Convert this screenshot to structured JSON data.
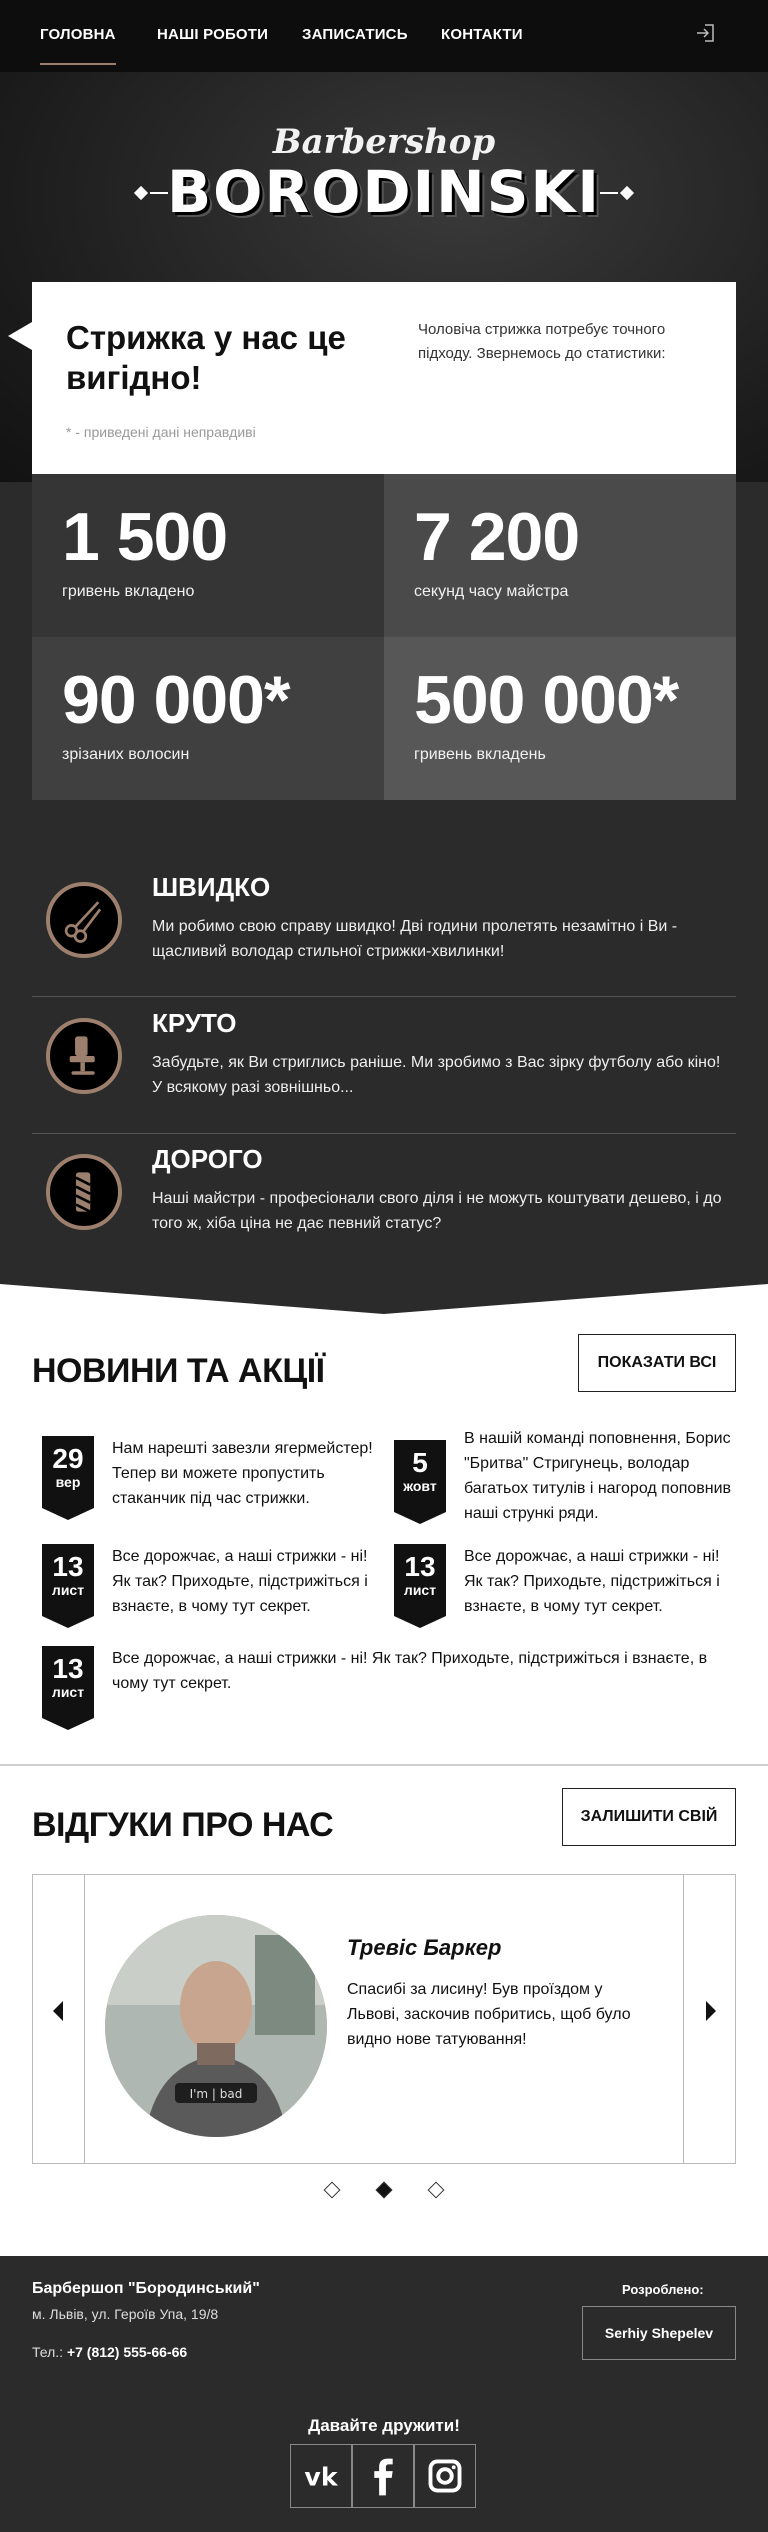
{
  "nav": {
    "items": [
      {
        "label": "ГОЛОВНА"
      },
      {
        "label": "НАШІ РОБОТИ"
      },
      {
        "label": "ЗАПИСАТИСЬ"
      },
      {
        "label": "КОНТАКТИ"
      }
    ],
    "login_icon": "login-icon"
  },
  "hero": {
    "script": "Barbershop",
    "title": "BORODINSKI"
  },
  "intro": {
    "title": "Стрижка у нас це вигідно!",
    "note": "* - приведені дані неправдиві",
    "text": "Чоловіча стрижка потребує точного підходу. Звернемось до статистики:"
  },
  "stats": [
    {
      "value": "1 500",
      "label": "гривень вкладено",
      "color": "#353535"
    },
    {
      "value": "7 200",
      "label": "секунд часу майстра",
      "color": "#4a4a4a"
    },
    {
      "value": "90 000*",
      "label": "зрізаних волосин",
      "color": "#404040"
    },
    {
      "value": "500 000*",
      "label": "гривень вкладень",
      "color": "#575757"
    }
  ],
  "features": [
    {
      "title": "ШВИДКО",
      "text": "Ми робимо свою справу швидко! Дві години пролетять незамітно і Ви - щасливий володар стильної стрижки-хвилинки!",
      "icon": "scissors-icon"
    },
    {
      "title": "КРУТО",
      "text": "Забудьте, як Ви стриглись раніше. Ми зробимо з Вас зірку футболу або кіно! У всякому разі зовнішньо...",
      "icon": "barber-chair-icon"
    },
    {
      "title": "ДОРОГО",
      "text": "Наші майстри - професіонали свого діля і не можуть коштувати дешево, і до того ж, хіба ціна не дає певний статус?",
      "icon": "barber-pole-icon"
    }
  ],
  "news": {
    "title": "НОВИНИ ТА АКЦІЇ",
    "button": "ПОКАЗАТИ ВСІ",
    "items": [
      {
        "day": "29",
        "month": "вер",
        "text": "Нам нарешті завезли ягермейстер! Тепер ви можете пропустить стаканчик під час стрижки."
      },
      {
        "day": "5",
        "month": "жовт",
        "text": "В нашій команді поповнення, Борис \"Бритва\" Стригунець, володар багатьох титулів і нагород поповнив наші стрункі ряди."
      },
      {
        "day": "13",
        "month": "лист",
        "text": "Все дорожчає, а наші стрижки - ні! Як так? Приходьте, підстрижіться і взнаєте, в чому тут секрет."
      },
      {
        "day": "13",
        "month": "лист",
        "text": "Все дорожчає, а наші стрижки - ні! Як так? Приходьте, підстрижіться і взнаєте, в чому тут секрет."
      },
      {
        "day": "13",
        "month": "лист",
        "text": "Все дорожчає, а наші стрижки - ні! Як так? Приходьте, підстрижіться і взнаєте, в чому тут секрет."
      }
    ]
  },
  "reviews": {
    "title": "ВІДГУКИ ПРО НАС",
    "button": "ЗАЛИШИТИ СВІЙ",
    "name": "Тревіс Баркер",
    "text": "Спасибі за лисину! Був проїздом у Львові, заскочив побритись, щоб було видно нове татуювання!",
    "prev_icon": "arrow-left-icon",
    "next_icon": "arrow-right-icon",
    "active_slide": 2,
    "slide_count": 3
  },
  "footer": {
    "name": "Барбершоп \"Бородинський\"",
    "address": "м. Львів, ул. Героїв Упа, 19/8",
    "phone_label": "Тел.:",
    "phone": "+7 (812) 555-66-66",
    "made_by": "Розроблено:",
    "developer": "Serhiy Shepelev",
    "friends": "Давайте дружити!",
    "social": [
      "vk-icon",
      "facebook-icon",
      "instagram-icon"
    ]
  }
}
